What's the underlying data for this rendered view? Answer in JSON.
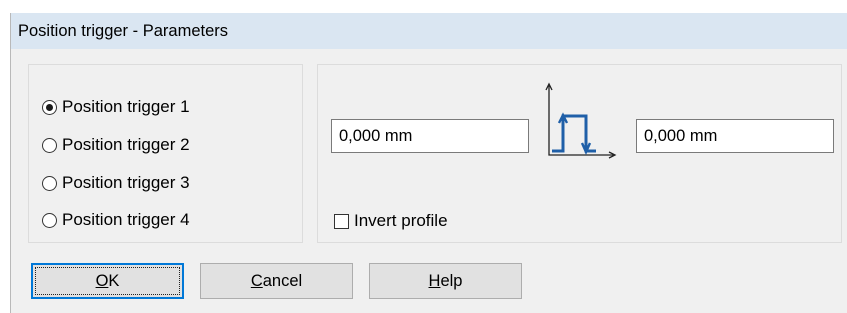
{
  "window": {
    "title": "Position trigger - Parameters"
  },
  "triggers": {
    "options": [
      {
        "label": "Position trigger 1",
        "checked": true
      },
      {
        "label": "Position trigger 2",
        "checked": false
      },
      {
        "label": "Position trigger 3",
        "checked": false
      },
      {
        "label": "Position trigger 4",
        "checked": false
      }
    ]
  },
  "profile": {
    "start_value": "0,000 mm",
    "end_value": "0,000 mm",
    "invert_label": "Invert profile",
    "invert_checked": false,
    "icon": "pulse-profile-icon",
    "icon_color": "#1f5fa8"
  },
  "buttons": {
    "ok_label": "OK",
    "cancel_label": "Cancel",
    "help_label": "Help"
  },
  "colors": {
    "titlebar": "#dae6f2",
    "focus_border": "#0078d7",
    "dialog_bg": "#f0f0f0"
  }
}
